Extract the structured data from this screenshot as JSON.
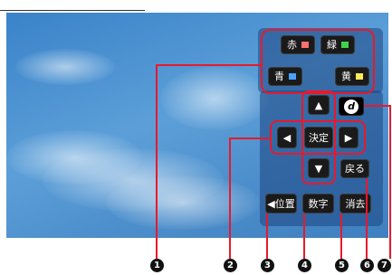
{
  "header": {
    "title": ""
  },
  "buttons": {
    "red": "赤",
    "green": "緑",
    "blue": "青",
    "yellow": "黄",
    "up": "▲",
    "left": "◀",
    "enter": "決定",
    "right": "▶",
    "down": "▼",
    "d_button": "d",
    "back": "戻る",
    "position": "◀位置",
    "numbers": "数字",
    "clear": "消去"
  },
  "colors": {
    "red": "#ff6f6f",
    "green": "#40d34c",
    "blue": "#4aa0ff",
    "yellow": "#ffe85a",
    "highlight": "#e8192c"
  },
  "callouts": [
    {
      "number": "1"
    },
    {
      "number": "2"
    },
    {
      "number": "3"
    },
    {
      "number": "4"
    },
    {
      "number": "5"
    },
    {
      "number": "6"
    },
    {
      "number": "7"
    }
  ]
}
